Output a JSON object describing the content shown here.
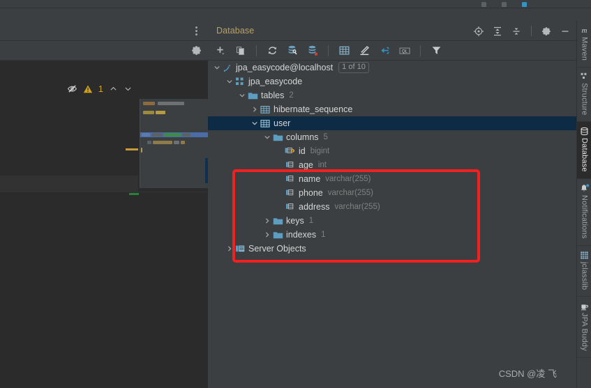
{
  "window": {
    "theme_bg": "#3c3f41",
    "editor_bg": "#2b2b2b",
    "accent_blue": "#3592c4",
    "selection_bg": "#0d2b45",
    "annotation_color": "#f42020"
  },
  "editor": {
    "inspection": {
      "hide_icon": "eye-off-icon",
      "warning_icon": "warning-triangle-icon",
      "warning_count": "1",
      "prev_icon": "chevron-up-icon",
      "next_icon": "chevron-down-icon"
    },
    "kebab_icon": "more-vertical-icon",
    "settings_icon": "gear-icon"
  },
  "database_panel": {
    "header": {
      "title": "Database",
      "actions": [
        {
          "name": "locate-in-tree-button",
          "icon": "crosshair-icon"
        },
        {
          "name": "expand-all-button",
          "icon": "expand-all-icon"
        },
        {
          "name": "collapse-all-button",
          "icon": "collapse-all-icon"
        },
        {
          "name": "settings-button",
          "icon": "gear-icon"
        },
        {
          "name": "hide-button",
          "icon": "minimize-icon"
        }
      ]
    },
    "toolbar": [
      {
        "name": "add-button",
        "icon": "plus-dropdown-icon",
        "tooltip": "New"
      },
      {
        "name": "duplicate-button",
        "icon": "copy-icon",
        "tooltip": "Duplicate"
      },
      {
        "name": "refresh-button",
        "icon": "refresh-icon",
        "tooltip": "Refresh"
      },
      {
        "name": "modify-datasource-button",
        "icon": "database-wrench-icon",
        "tooltip": "Modify"
      },
      {
        "name": "datasource-properties-button",
        "icon": "database-properties-icon",
        "tooltip": "Properties"
      },
      {
        "name": "open-table-editor-button",
        "icon": "table-icon",
        "tooltip": "Data Editor"
      },
      {
        "name": "modify-object-button",
        "icon": "pencil-icon",
        "tooltip": "Modify Object"
      },
      {
        "name": "jump-to-editor-button",
        "icon": "jump-to-icon",
        "tooltip": "Jump to Query Console"
      },
      {
        "name": "query-console-button",
        "icon": "ql-console-icon",
        "tooltip": "New Query Console"
      },
      {
        "name": "filter-button",
        "icon": "filter-icon",
        "tooltip": "Filter"
      }
    ],
    "tree": [
      {
        "name": "tree-node-datasource",
        "label": "jpa_easycode@localhost",
        "icon": "mysql-datasource-icon",
        "indent": 0,
        "twisty": "expanded",
        "badge": "1 of 10",
        "selected": false
      },
      {
        "name": "tree-node-schema",
        "label": "jpa_easycode",
        "icon": "schema-icon",
        "indent": 1,
        "twisty": "expanded",
        "selected": false
      },
      {
        "name": "tree-node-tables-group",
        "label": "tables",
        "icon": "folder-icon",
        "indent": 2,
        "twisty": "expanded",
        "count": "2",
        "selected": false
      },
      {
        "name": "tree-node-table-hibernate-sequence",
        "label": "hibernate_sequence",
        "icon": "table-icon",
        "indent": 3,
        "twisty": "collapsed",
        "selected": false
      },
      {
        "name": "tree-node-table-user",
        "label": "user",
        "icon": "table-icon",
        "indent": 3,
        "twisty": "expanded",
        "selected": true
      },
      {
        "name": "tree-node-columns-group",
        "label": "columns",
        "icon": "folder-icon",
        "indent": 4,
        "twisty": "expanded",
        "count": "5",
        "selected": false
      },
      {
        "name": "tree-node-column-id",
        "label": "id",
        "icon": "primary-key-column-icon",
        "indent": 5,
        "twisty": "none",
        "type": "bigint",
        "selected": false
      },
      {
        "name": "tree-node-column-age",
        "label": "age",
        "icon": "column-icon",
        "indent": 5,
        "twisty": "none",
        "type": "int",
        "selected": false
      },
      {
        "name": "tree-node-column-name",
        "label": "name",
        "icon": "column-icon",
        "indent": 5,
        "twisty": "none",
        "type": "varchar(255)",
        "selected": false
      },
      {
        "name": "tree-node-column-phone",
        "label": "phone",
        "icon": "column-icon",
        "indent": 5,
        "twisty": "none",
        "type": "varchar(255)",
        "selected": false
      },
      {
        "name": "tree-node-column-address",
        "label": "address",
        "icon": "column-icon",
        "indent": 5,
        "twisty": "none",
        "type": "varchar(255)",
        "selected": false
      },
      {
        "name": "tree-node-keys-group",
        "label": "keys",
        "icon": "folder-icon",
        "indent": 4,
        "twisty": "collapsed",
        "count": "1",
        "selected": false
      },
      {
        "name": "tree-node-indexes-group",
        "label": "indexes",
        "icon": "folder-icon",
        "indent": 4,
        "twisty": "collapsed",
        "count": "1",
        "selected": false
      },
      {
        "name": "tree-node-server-objects",
        "label": "Server Objects",
        "icon": "server-objects-icon",
        "indent": 1,
        "twisty": "collapsed",
        "selected": false
      }
    ]
  },
  "right_sidebar": [
    {
      "name": "sidebar-tab-maven",
      "label": "Maven",
      "icon": "maven-icon",
      "active": false,
      "dot": false
    },
    {
      "name": "sidebar-tab-structure",
      "label": "Structure",
      "icon": "structure-icon",
      "active": false,
      "dot": false
    },
    {
      "name": "sidebar-tab-database",
      "label": "Database",
      "icon": "database-icon",
      "active": true,
      "dot": false
    },
    {
      "name": "sidebar-tab-notifications",
      "label": "Notifications",
      "icon": "bell-icon",
      "active": false,
      "dot": true
    },
    {
      "name": "sidebar-tab-jclasslib",
      "label": "jclasslib",
      "icon": "jclasslib-icon",
      "active": false,
      "dot": false
    },
    {
      "name": "sidebar-tab-jpa-buddy",
      "label": "JPA Buddy",
      "icon": "jpa-buddy-icon",
      "active": false,
      "dot": false
    }
  ],
  "watermark": {
    "text": "CSDN @凌 飞"
  },
  "annotation": {
    "shape": "rectangle",
    "color": "#f42020",
    "target": "columns of table user"
  }
}
